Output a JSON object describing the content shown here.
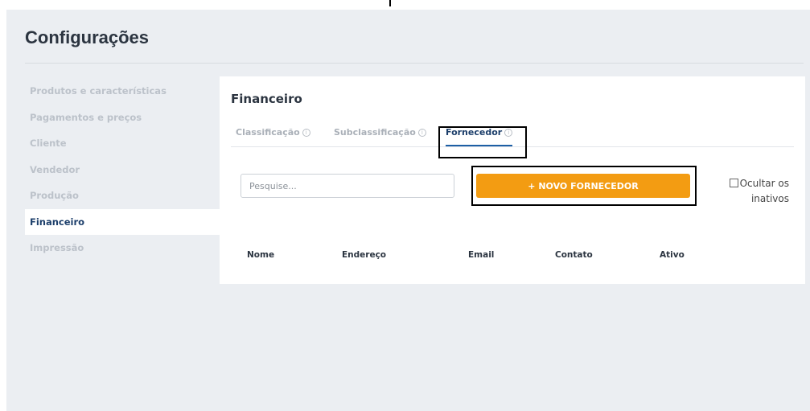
{
  "page": {
    "title": "Configurações"
  },
  "sidebar": {
    "items": [
      {
        "label": "Produtos e características"
      },
      {
        "label": "Pagamentos e preços"
      },
      {
        "label": "Cliente"
      },
      {
        "label": "Vendedor"
      },
      {
        "label": "Produção"
      },
      {
        "label": "Financeiro"
      },
      {
        "label": "Impressão"
      }
    ],
    "active_index": 5
  },
  "panel": {
    "title": "Financeiro",
    "tabs": [
      {
        "label": "Classificação",
        "info_icon": "info-circle-icon"
      },
      {
        "label": "Subclassificação",
        "info_icon": "info-circle-icon"
      },
      {
        "label": "Fornecedor",
        "info_icon": "info-circle-icon",
        "active": true
      }
    ],
    "search": {
      "placeholder": "Pesquise..."
    },
    "new_button": {
      "label": "+ NOVO FORNECEDOR"
    },
    "hide_inactive": {
      "label_line1": "Ocultar os",
      "label_line2": "inativos",
      "checked": false
    },
    "table": {
      "columns": [
        "Nome",
        "Endereço",
        "Email",
        "Contato",
        "Ativo"
      ],
      "rows": []
    }
  },
  "colors": {
    "accent_orange": "#f39c12",
    "active_navy": "#1d3f6b",
    "background": "#ebeef2"
  }
}
